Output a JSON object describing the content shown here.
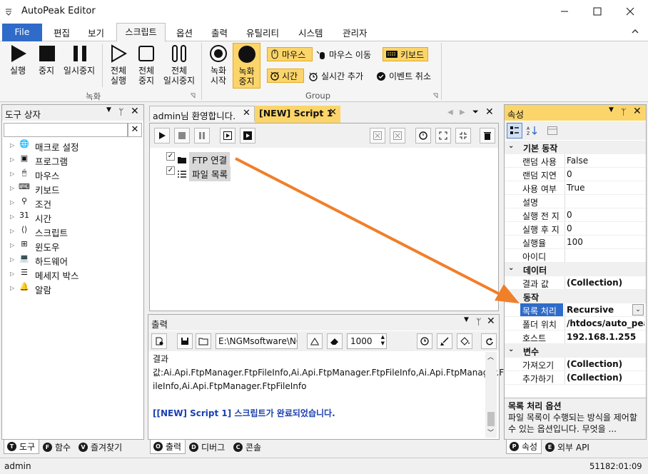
{
  "app": {
    "title": "AutoPeak Editor"
  },
  "menu": {
    "file": "File",
    "items": [
      "편집",
      "보기",
      "스크립트",
      "옵션",
      "출력",
      "유틸리티",
      "시스템",
      "관리자"
    ]
  },
  "ribbon": {
    "run": "실행",
    "stop": "중지",
    "pause": "일시중지",
    "all_run": "전체\n실행",
    "all_stop": "전체\n중지",
    "all_pause": "전체\n일시중지",
    "record_start": "녹화\n시작",
    "record_stop": "녹화\n중지",
    "group_record": "녹화",
    "group_group": "Group",
    "mouse": "마우스",
    "mouse_move": "마우스 이동",
    "keyboard": "키보드",
    "time": "시간",
    "realtime_add": "실시간 추가",
    "event_cancel": "이벤트 취소"
  },
  "toolbox": {
    "title": "도구 상자",
    "items": [
      "매크로 설정",
      "프로그램",
      "마우스",
      "키보드",
      "조건",
      "시간",
      "스크립트",
      "윈도우",
      "하드웨어",
      "메세지 박스",
      "알람"
    ],
    "tabs": [
      "도구",
      "함수",
      "즐겨찾기"
    ],
    "tab_badges": [
      "T",
      "F",
      "V"
    ]
  },
  "editor": {
    "tabs": [
      "admin님 환영합니다.",
      "[NEW] Script 1"
    ],
    "nodes": [
      "FTP 연결",
      "파일 목록"
    ]
  },
  "output": {
    "title": "출력",
    "path": "E:\\NGMsoftware\\NG",
    "count": "1000",
    "lines": [
      "결과",
      "값:Ai.Api.FtpManager.FtpFileInfo,Ai.Api.FtpManager.FtpFileInfo,Ai.Api.FtpManager.FtpF",
      "ileInfo,Ai.Api.FtpManager.FtpFileInfo"
    ],
    "done": "[[NEW] Script 1] 스크립트가 완료되었습니다.",
    "tabs": [
      "출력",
      "디버그",
      "콘솔"
    ],
    "tab_badges": [
      "O",
      "D",
      "C"
    ]
  },
  "properties": {
    "title": "속성",
    "categories": [
      {
        "name": "기본 동작",
        "rows": [
          [
            "랜덤 사용",
            "False"
          ],
          [
            "랜덤 지연",
            "0"
          ],
          [
            "사용 여부",
            "True"
          ],
          [
            "설명",
            ""
          ],
          [
            "실행 전 지",
            "0"
          ],
          [
            "실행 후 지",
            "0"
          ],
          [
            "실행율",
            "100"
          ],
          [
            "아이디",
            ""
          ]
        ]
      },
      {
        "name": "데이터",
        "rows": [
          [
            "결과 값",
            "(Collection)"
          ]
        ]
      },
      {
        "name": "동작",
        "rows": [
          [
            "목록 처리",
            "Recursive"
          ],
          [
            "폴더 위치",
            "/htdocs/auto_peak"
          ],
          [
            "호스트",
            "192.168.1.255"
          ]
        ]
      },
      {
        "name": "변수",
        "rows": [
          [
            "가져오기",
            "(Collection)"
          ],
          [
            "추가하기",
            "(Collection)"
          ]
        ]
      }
    ],
    "desc_title": "목록 처리 옵션",
    "desc_text": "파일 목록이 수행되는 방식을 제어할 수 있는 옵션입니다. 무엇을 ...",
    "tabs": [
      "속성",
      "외부 API"
    ],
    "tab_badges": [
      "P",
      "E"
    ]
  },
  "status": {
    "user": "admin",
    "time": "51182:01:09"
  },
  "colors": {
    "accent": "#2f6bc8",
    "highlight": "#fcd56a",
    "arrow": "#f07f2a",
    "link": "#1a3fb0"
  }
}
